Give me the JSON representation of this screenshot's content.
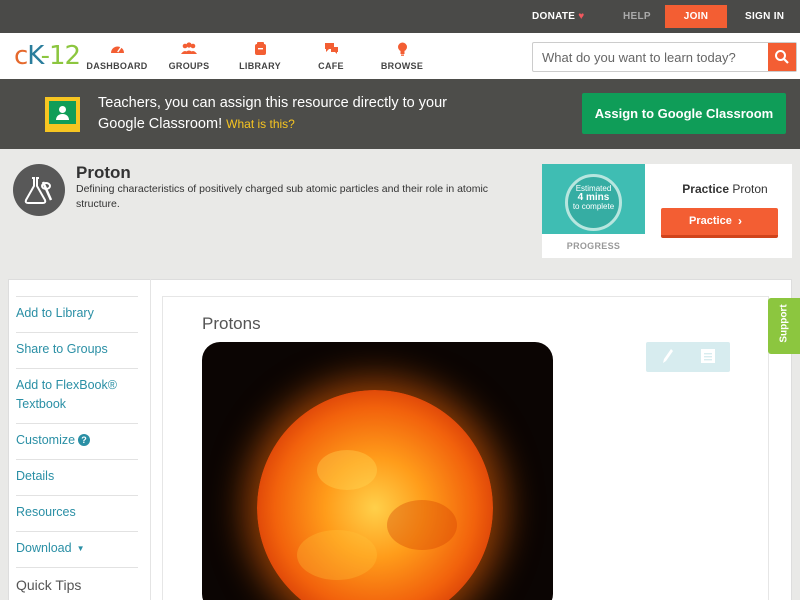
{
  "topbar": {
    "donate": "DONATE",
    "help": "HELP",
    "join": "JOIN",
    "signin": "SIGN IN"
  },
  "brand": {
    "logo_c": "c",
    "logo_k": "K",
    "logo_dash": "-",
    "logo_12": "12"
  },
  "nav": {
    "items": [
      {
        "label": "DASHBOARD",
        "icon": "dashboard-icon"
      },
      {
        "label": "GROUPS",
        "icon": "groups-icon"
      },
      {
        "label": "LIBRARY",
        "icon": "library-icon"
      },
      {
        "label": "CAFE",
        "icon": "cafe-icon"
      },
      {
        "label": "BROWSE",
        "icon": "browse-icon"
      }
    ],
    "search_placeholder": "What do you want to learn today?"
  },
  "banner": {
    "text": "Teachers, you can assign this resource directly to your Google Classroom!",
    "what_link": "What is this?",
    "assign_button": "Assign to Google Classroom"
  },
  "concept": {
    "title": "Proton",
    "description": "Defining characteristics of positively charged sub atomic particles and their role in atomic structure."
  },
  "practice": {
    "estimated": "Estimated",
    "mins": "4 mins",
    "to_complete": "to complete",
    "progress_label": "PROGRESS",
    "title_bold": "Practice",
    "title_rest": "Proton",
    "button": "Practice"
  },
  "sidebar": {
    "items": [
      {
        "label": "Add to Library"
      },
      {
        "label": "Share to Groups"
      },
      {
        "label": "Add to FlexBook® Textbook"
      },
      {
        "label": "Customize"
      },
      {
        "label": "Details"
      },
      {
        "label": "Resources"
      },
      {
        "label": "Download"
      }
    ],
    "quick_tips": "Quick Tips"
  },
  "content": {
    "title": "Protons"
  },
  "support": {
    "label": "Support"
  },
  "colors": {
    "accent": "#f35e33",
    "link": "#2a8fa5",
    "google_green": "#0f9d58",
    "support_green": "#8cc63f"
  }
}
